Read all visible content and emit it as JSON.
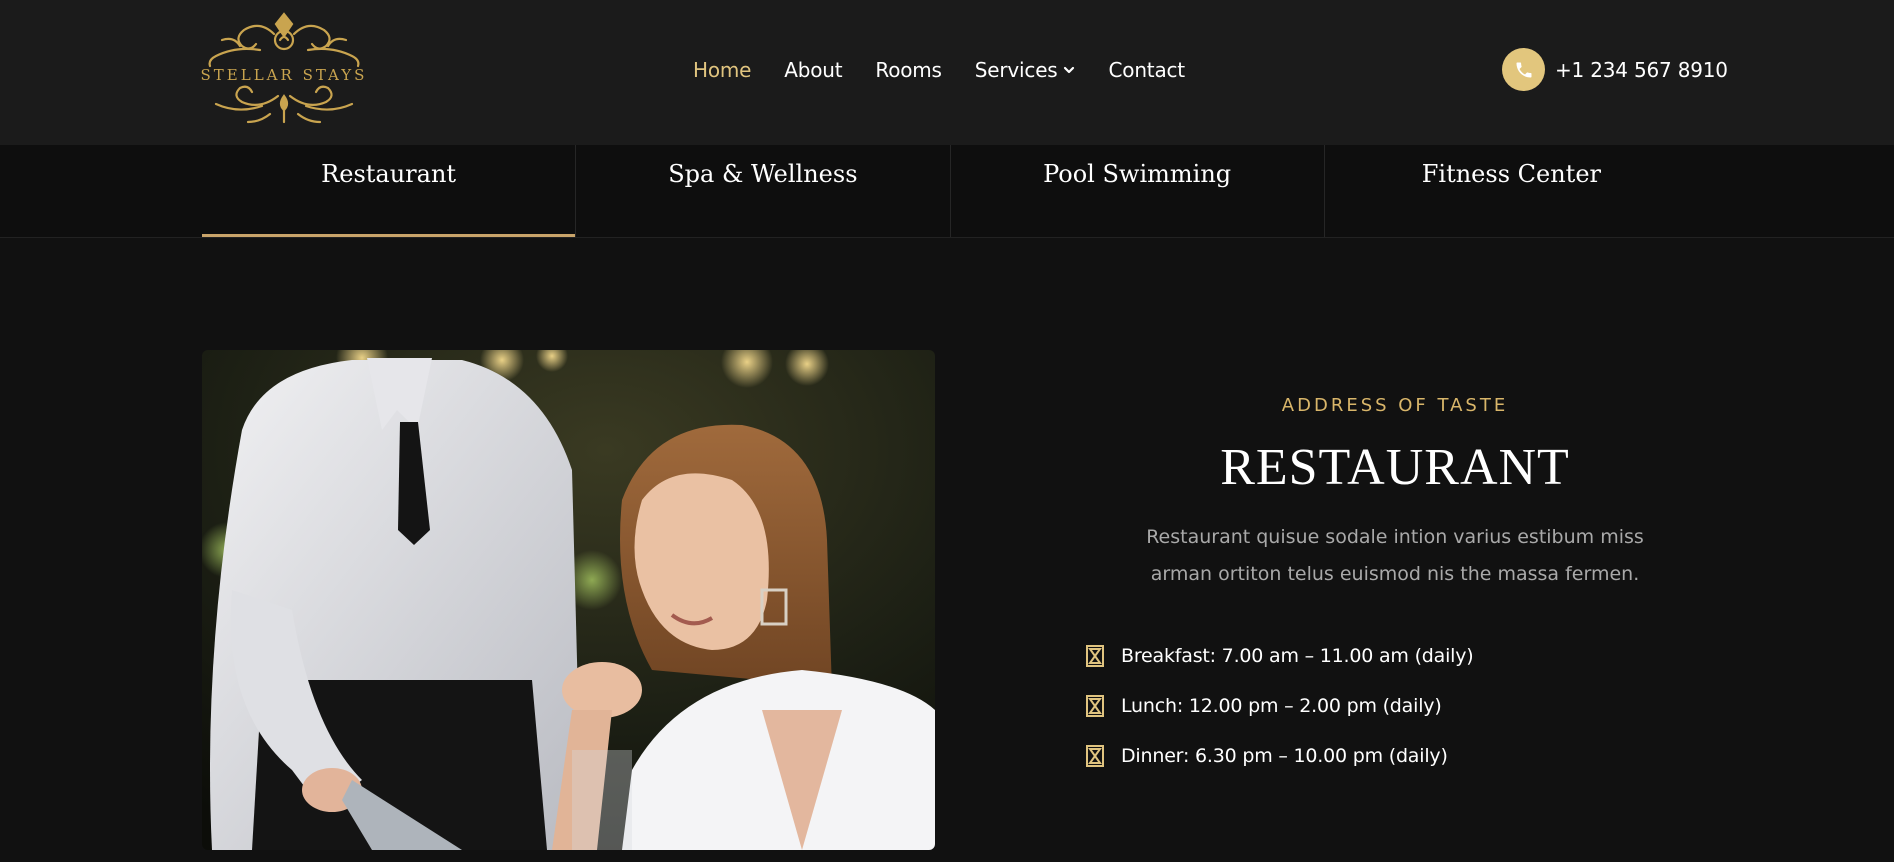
{
  "brand": {
    "logo_text": "STELLAR STAYS",
    "accent": "#e0c47f"
  },
  "nav": {
    "items": [
      {
        "label": "Home",
        "active": true
      },
      {
        "label": "About"
      },
      {
        "label": "Rooms"
      },
      {
        "label": "Services",
        "dropdown": true
      },
      {
        "label": "Contact"
      }
    ]
  },
  "contact": {
    "phone": "+1 234 567 8910",
    "icon": "phone-icon"
  },
  "tabs": [
    {
      "label": "Restaurant",
      "active": true
    },
    {
      "label": "Spa & Wellness"
    },
    {
      "label": "Pool Swimming"
    },
    {
      "label": "Fitness Center"
    }
  ],
  "section": {
    "eyebrow": "ADDRESS OF TASTE",
    "title": "RESTAURANT",
    "description": "Restaurant quisue sodale intion varius estibum miss arman ortiton telus euismod nis the massa fermen.",
    "hours": [
      {
        "text": "Breakfast: 7.00 am – 11.00 am (daily)",
        "icon": "hourglass-icon"
      },
      {
        "text": "Lunch: 12.00 pm – 2.00 pm (daily)",
        "icon": "hourglass-icon"
      },
      {
        "text": "Dinner: 6.30 pm – 10.00 pm (daily)",
        "icon": "hourglass-icon"
      }
    ]
  }
}
